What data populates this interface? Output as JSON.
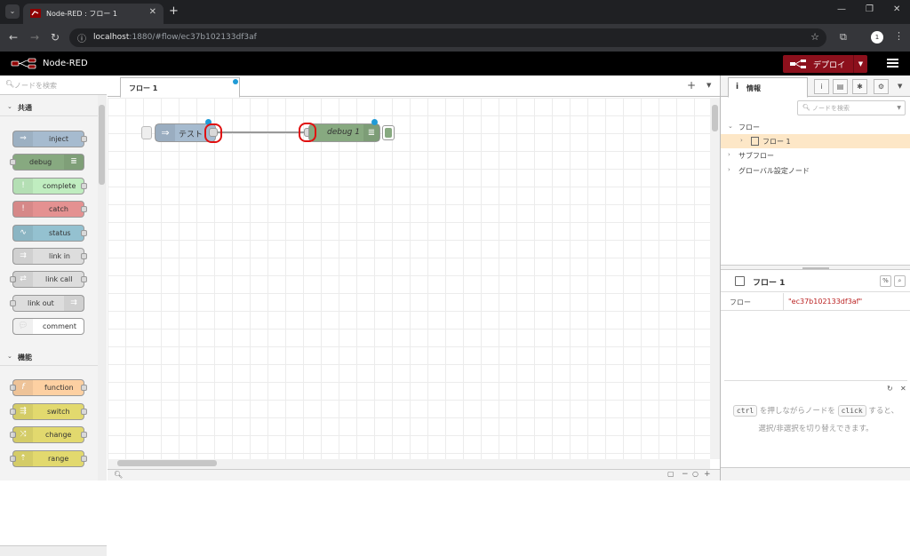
{
  "browser": {
    "tab_title": "Node-RED : フロー 1",
    "tab_close": "✕",
    "new_tab": "+",
    "url_host": "localhost",
    "url_path": ":1880/#flow/ec37b102133df3af",
    "profile_initial": "1"
  },
  "header": {
    "title": "Node-RED",
    "deploy_label": "デプロイ"
  },
  "palette": {
    "search_placeholder": "ノードを検索",
    "categories": [
      {
        "label": "共通"
      },
      {
        "label": "機能"
      }
    ],
    "nodes": [
      {
        "label": "inject",
        "color": "#a6bbcf"
      },
      {
        "label": "debug",
        "color": "#87a980"
      },
      {
        "label": "complete",
        "color": "#c0edc0"
      },
      {
        "label": "catch",
        "color": "#e49191"
      },
      {
        "label": "status",
        "color": "#94c1d0"
      },
      {
        "label": "link in",
        "color": "#dddddd"
      },
      {
        "label": "link call",
        "color": "#dddddd"
      },
      {
        "label": "link out",
        "color": "#dddddd"
      },
      {
        "label": "comment",
        "color": "#ffffff"
      },
      {
        "label": "function",
        "color": "#fdd0a2"
      },
      {
        "label": "switch",
        "color": "#e2d96e"
      },
      {
        "label": "change",
        "color": "#e2d96e"
      },
      {
        "label": "range",
        "color": "#e2d96e"
      }
    ]
  },
  "workspace": {
    "tab_label": "フロー 1",
    "add": "+",
    "nodes": {
      "inject": {
        "label": "テスト",
        "color": "#a6bbcf"
      },
      "debug": {
        "label": "debug 1",
        "color": "#87a980"
      }
    }
  },
  "sidebar": {
    "tab_label": "情報",
    "tab_icon": "i",
    "search_placeholder": "ノードを検索",
    "tree": {
      "flows": "フロー",
      "flow1": "フロー 1",
      "subflows": "サブフロー",
      "global_config": "グローバル設定ノード"
    },
    "props": {
      "title": "フロー 1",
      "key": "フロー",
      "value": "\"ec37b102133df3af\""
    },
    "help": {
      "key1": "ctrl",
      "text1": "を押しながらノードを",
      "key2": "click",
      "text2": "すると、選択/非選択を切り替えできます。"
    }
  },
  "colors": {
    "deploy": "#8c101c",
    "header_bg": "#000000",
    "selection_highlight": "#fde7c7",
    "annotation_ring": "#e01010",
    "changed_dot": "#209bd6"
  }
}
